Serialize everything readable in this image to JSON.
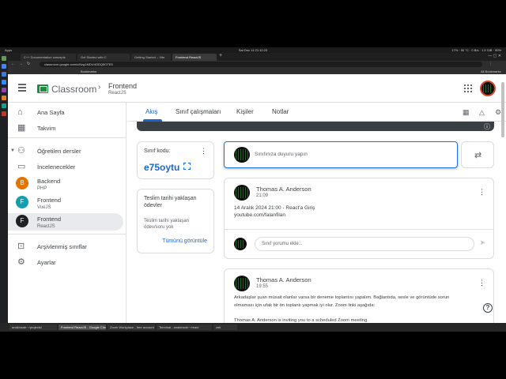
{
  "os": {
    "left": "Apps",
    "clock": "Sat Dec 14  21:10:23",
    "right": "17% · 50 °C · 0 B/s · 1.5 GiB · 90%"
  },
  "browser": {
    "tabs": [
      {
        "label": "C++ Documentation concepts",
        "active": false
      },
      {
        "label": "Get Started with C",
        "active": false
      },
      {
        "label": "Getting Started – Vite",
        "active": false
      },
      {
        "label": "Frontend ReactJS",
        "active": true
      }
    ],
    "url": "classroom.google.com/c/Nzg1MDU4ODQ5OTE5",
    "bookmarks_label": "Bookmarks",
    "all_bookmarks": "All Bookmarks"
  },
  "app": {
    "brand": "Classroom",
    "course_title": "Frontend",
    "course_subtitle": "ReactJS"
  },
  "sidebar": {
    "home": "Ana Sayfa",
    "calendar": "Takvim",
    "teaching": "Öğretilen dersler",
    "review": "İncelenecekler",
    "courses": [
      {
        "letter": "B",
        "name": "Backend",
        "section": "PHP",
        "color": "#e37400"
      },
      {
        "letter": "F",
        "name": "Frontend",
        "section": "VueJS",
        "color": "#129eaf"
      },
      {
        "letter": "F",
        "name": "Frontend",
        "section": "ReactJS",
        "color": "#202124"
      }
    ],
    "archived": "Arşivlenmiş sınıflar",
    "settings": "Ayarlar"
  },
  "tabs": {
    "stream": "Akış",
    "classwork": "Sınıf çalışmaları",
    "people": "Kişiler",
    "grades": "Notlar"
  },
  "class_code": {
    "title": "Sınıf kodu:",
    "value": "e75oytu"
  },
  "due": {
    "title": "Teslim tarihi yaklaşan ödevler",
    "text": "Teslim tarihi yaklaşan ödev/soru yok",
    "view_all": "Tümünü görüntüle"
  },
  "announce": {
    "placeholder": "Sınıfınıza duyuru yapın"
  },
  "posts": [
    {
      "author": "Thomas A. Anderson",
      "time": "21:09",
      "lines": [
        "14 Aralık 2024 21:00 - React'a Giriş",
        "youtube.com/falanfilan"
      ],
      "comment_placeholder": "Sınıf yorumu ekle..."
    },
    {
      "author": "Thomas A. Anderson",
      "time": "19:55",
      "lines": [
        "Arkadaşlar şuan müsait olanlar varsa bir deneme toplantısı yapalım. Bağlantıda, sesle ve görüntüde sorun",
        "olmaması için ufak bir ön toplantı yapmak iyi olur. Zoom linki aşağıda:",
        "Thomas A. Anderson is inviting you to a scheduled Zoom meeting."
      ]
    }
  ],
  "taskbar": [
    {
      "label": "anakinsde:~/projects/",
      "active": false
    },
    {
      "label": "Frontend ReactJS - Google Chrome",
      "active": true
    },
    {
      "label": "Zoom Workplace - free account",
      "active": false
    },
    {
      "label": "Terminal - anakinsde:~/react",
      "active": false
    },
    {
      "label": "zsh",
      "active": false
    }
  ]
}
